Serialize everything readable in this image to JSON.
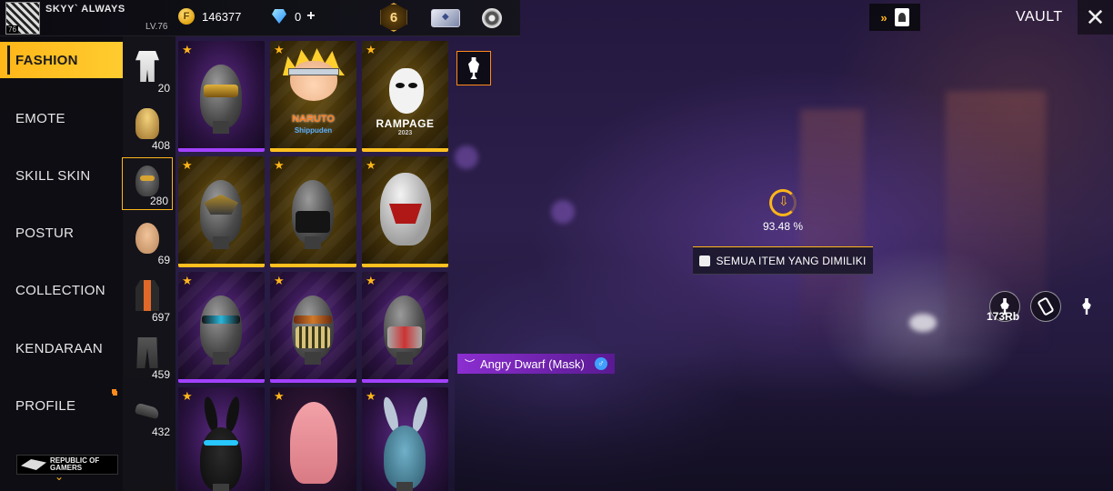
{
  "player": {
    "name": "SKYY` ALWAYS",
    "level": "LV.76",
    "avatar_level": "76"
  },
  "currency": {
    "gold": "146377",
    "diamonds": "0",
    "diamonds_plus": "+"
  },
  "rank_badge": "6",
  "nav": {
    "items": [
      {
        "label": "FASHION",
        "active": true
      },
      {
        "label": "EMOTE",
        "active": false
      },
      {
        "label": "SKILL SKIN",
        "active": false
      },
      {
        "label": "POSTUR",
        "active": false
      },
      {
        "label": "COLLECTION",
        "active": false
      },
      {
        "label": "KENDARAAN",
        "active": false
      },
      {
        "label": "PROFILE",
        "active": false
      }
    ],
    "footer_logo": {
      "line1": "REPUBLIC OF",
      "line2": "GAMERS"
    }
  },
  "subcategories": [
    {
      "icon": "outfit-icon",
      "count": "20"
    },
    {
      "icon": "hair-icon",
      "count": "408"
    },
    {
      "icon": "mask-icon",
      "count": "280",
      "selected": true
    },
    {
      "icon": "face-icon",
      "count": "69"
    },
    {
      "icon": "jacket-icon",
      "count": "697"
    },
    {
      "icon": "pants-icon",
      "count": "459"
    },
    {
      "icon": "shoes-icon",
      "count": "432"
    }
  ],
  "items": [
    {
      "name": "gold-visor-mask",
      "rarity": "purple"
    },
    {
      "name": "naruto-mask",
      "rarity": "gold",
      "logo": "NARUTO",
      "logo_sub": "Shippuden"
    },
    {
      "name": "rampage-mask",
      "rarity": "gold",
      "logo": "RAMPAGE",
      "logo_sub": "2023"
    },
    {
      "name": "gold-ornament-mask",
      "rarity": "gold"
    },
    {
      "name": "black-cloth-mask",
      "rarity": "gold"
    },
    {
      "name": "red-white-helmet",
      "rarity": "gold"
    },
    {
      "name": "sunglasses-mask",
      "rarity": "purple"
    },
    {
      "name": "angry-dwarf-mask",
      "rarity": "purple"
    },
    {
      "name": "bandana-mask",
      "rarity": "purple"
    },
    {
      "name": "black-bunny-mask",
      "rarity": "purple"
    },
    {
      "name": "pink-hood-mask",
      "rarity": "purple"
    },
    {
      "name": "blue-bunny-mask",
      "rarity": "purple"
    }
  ],
  "selected_item": {
    "label": "Angry Dwarf (Mask)",
    "gender_symbol": "♂"
  },
  "collection": {
    "percent": "93.48 %"
  },
  "owned_button": {
    "label": "SEMUA ITEM YANG DIMILIKI"
  },
  "vault": {
    "title": "VAULT"
  },
  "likes": {
    "count": "173Rb"
  },
  "colors": {
    "accent": "#ffb619",
    "purple_rarity": "#a241ff",
    "gold_rarity": "#ffbf1f"
  }
}
